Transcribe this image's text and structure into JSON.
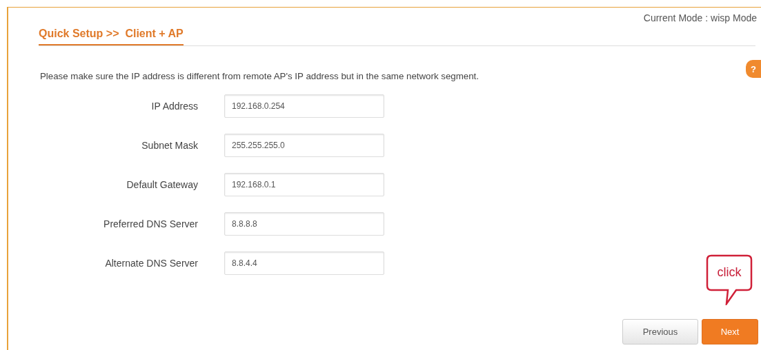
{
  "mode_label": "Current Mode : wisp Mode",
  "title": "Quick Setup >>  Client + AP",
  "help_tab": "?",
  "instruction": "Please make sure the IP address is different from remote AP's IP address but in the same network segment.",
  "fields": [
    {
      "label": "IP Address",
      "value": "192.168.0.254"
    },
    {
      "label": "Subnet Mask",
      "value": "255.255.255.0"
    },
    {
      "label": "Default Gateway",
      "value": "192.168.0.1"
    },
    {
      "label": "Preferred DNS Server",
      "value": "8.8.8.8"
    },
    {
      "label": "Alternate DNS Server",
      "value": "8.8.4.4"
    }
  ],
  "callout": "click",
  "buttons": [
    {
      "label": "Previous",
      "kind": "secondary"
    },
    {
      "label": "Next",
      "kind": "primary"
    }
  ]
}
